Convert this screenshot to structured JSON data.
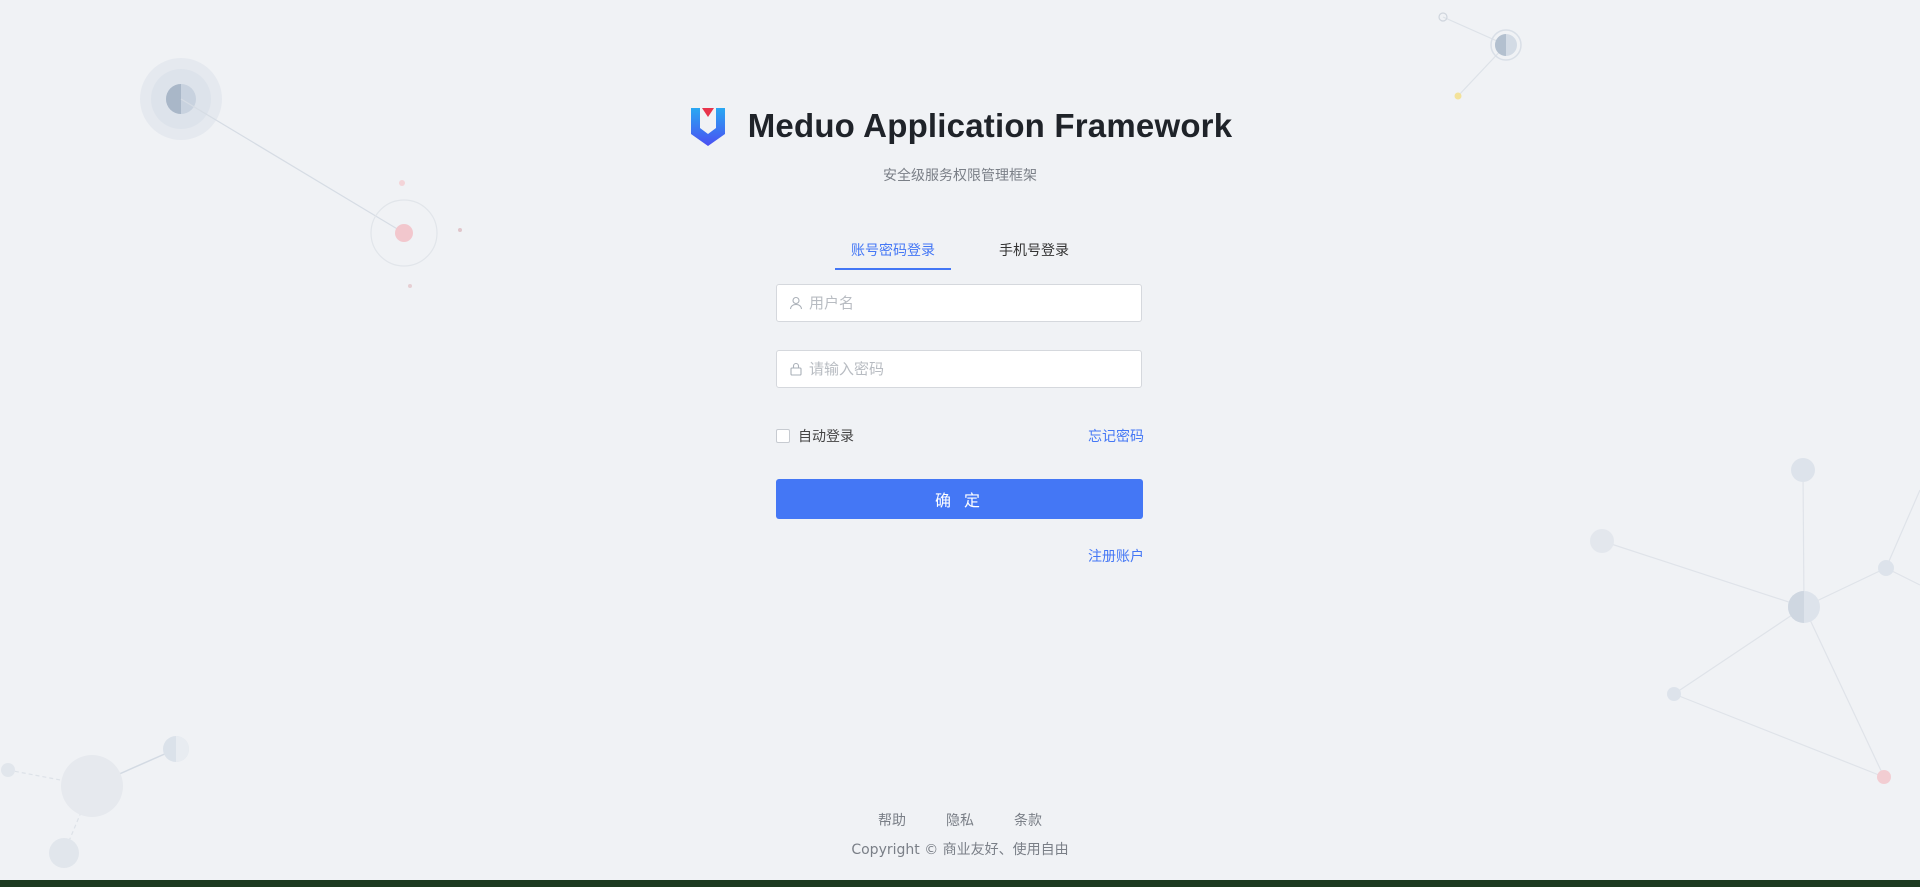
{
  "header": {
    "title": "Meduo Application Framework",
    "subtitle": "安全级服务权限管理框架",
    "logo": "shield-v-logo"
  },
  "login": {
    "tabs": [
      {
        "label": "账号密码登录",
        "active": true
      },
      {
        "label": "手机号登录",
        "active": false
      }
    ],
    "username": {
      "value": "",
      "placeholder": "用户名",
      "icon": "user-icon"
    },
    "password": {
      "value": "",
      "placeholder": "请输入密码",
      "icon": "lock-icon"
    },
    "remember_label": "自动登录",
    "remember_checked": false,
    "forgot_label": "忘记密码",
    "submit_label": "确 定",
    "register_label": "注册账户"
  },
  "footer": {
    "links": [
      "帮助",
      "隐私",
      "条款"
    ],
    "copyright": "Copyright © 商业友好、使用自由"
  },
  "colors": {
    "accent": "#4477f5",
    "background": "#f0f2f5",
    "text": "#1f2329",
    "muted": "#7a7f87"
  }
}
